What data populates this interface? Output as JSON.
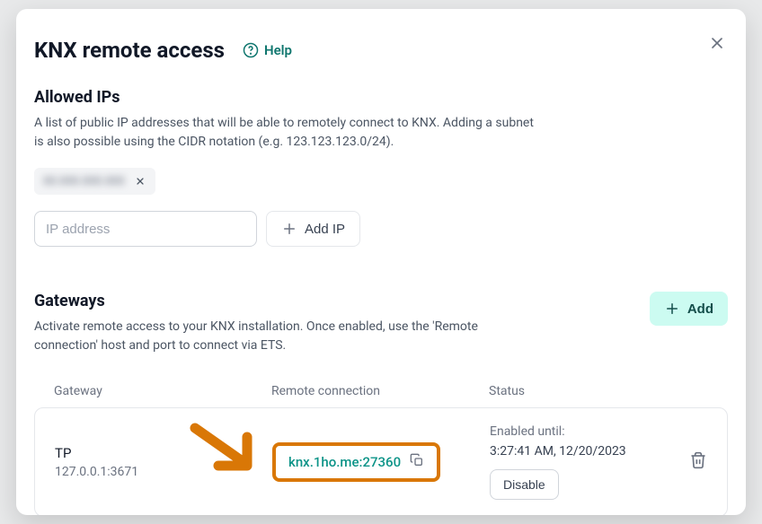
{
  "title": "KNX remote access",
  "help_label": "Help",
  "allowed_ips": {
    "title": "Allowed IPs",
    "desc": "A list of public IP addresses that will be able to remotely connect to KNX. Adding a subnet is also possible using the CIDR notation (e.g. 123.123.123.0/24).",
    "chip": "00.000.000.000",
    "placeholder": "IP address",
    "add_ip_label": "Add IP"
  },
  "gateways": {
    "title": "Gateways",
    "desc": "Activate remote access to your KNX installation. Once enabled, use the 'Remote connection' host and port to connect via ETS.",
    "add_label": "Add",
    "columns": {
      "gateway": "Gateway",
      "remote": "Remote connection",
      "status": "Status"
    },
    "row": {
      "name": "TP",
      "addr": "127.0.0.1:3671",
      "remote": "knx.1ho.me:27360",
      "enabled_label": "Enabled until:",
      "enabled_date": "3:27:41 AM, 12/20/2023",
      "disable_label": "Disable"
    }
  }
}
